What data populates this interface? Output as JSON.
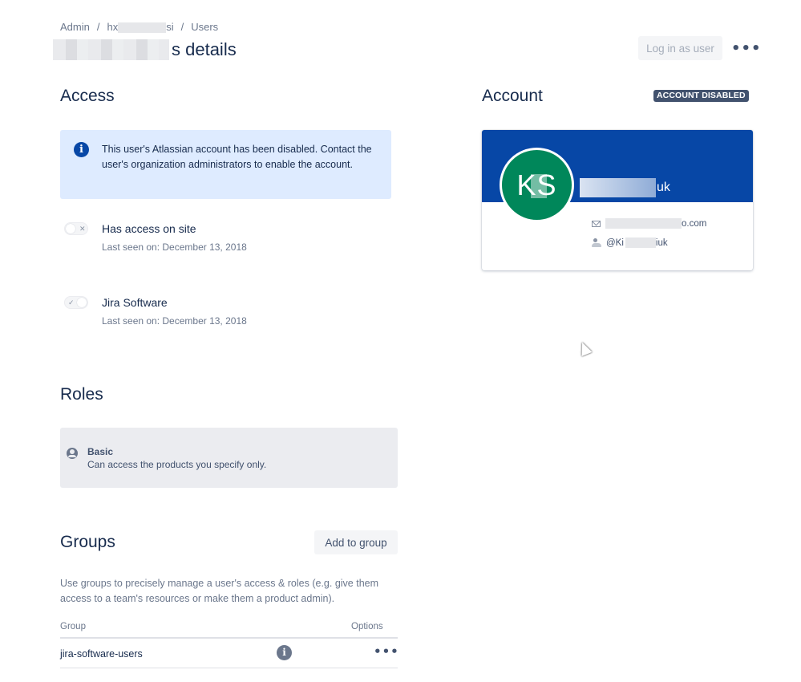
{
  "breadcrumb": {
    "items": [
      "Admin",
      "hx",
      "si",
      "Users"
    ],
    "separator": "/"
  },
  "header": {
    "title": "s details",
    "login_as_user": "Log in as user",
    "more": "•••"
  },
  "access": {
    "heading": "Access",
    "banner_icon": "i",
    "banner_text": "This user's Atlassian account has been disabled. Contact the user's organization administrators to enable the account.",
    "items": [
      {
        "name": "Has access on site",
        "last_seen": "Last seen on: December 13, 2018",
        "toggle_mark": "✕"
      },
      {
        "name": "Jira Software",
        "last_seen": "Last seen on: December 13, 2018",
        "toggle_mark": "✓"
      }
    ]
  },
  "roles": {
    "heading": "Roles",
    "role_title": "Basic",
    "role_description": "Can access the products you specify only."
  },
  "groups": {
    "heading": "Groups",
    "add_button": "Add to group",
    "description": "Use groups to precisely manage a user's access & roles (e.g. give them access to a team's resources or make them a product admin).",
    "col_group": "Group",
    "col_options": "Options",
    "rows": [
      {
        "name": "jira-software-users",
        "info": "i",
        "more": "•••"
      }
    ]
  },
  "account": {
    "heading": "Account",
    "status_badge": "ACCOUNT DISABLED",
    "avatar_initials": "KS",
    "name_suffix": "uk",
    "email_suffix": "o.com",
    "username_prefix": "@Ki",
    "username_suffix": "iuk"
  },
  "colors": {
    "brand_blue": "#0747a6",
    "avatar_green": "#00875a",
    "banner_bg": "#deebff",
    "badge_bg": "#42526e"
  }
}
